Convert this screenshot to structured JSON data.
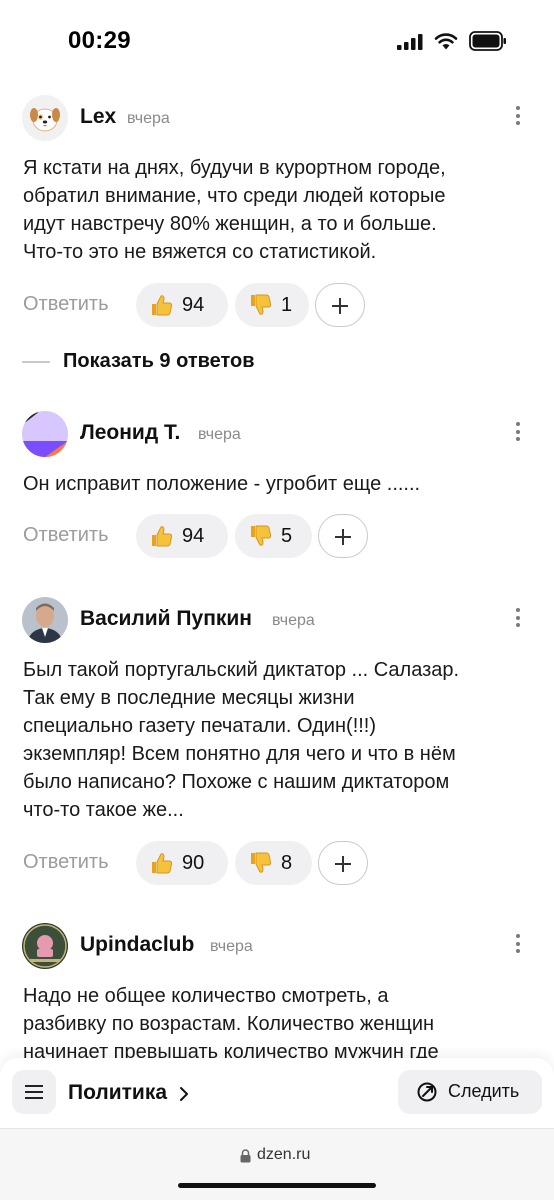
{
  "status": {
    "time": "00:29"
  },
  "comments": [
    {
      "author": "Lex",
      "time": "вчера",
      "text": [
        "Я кстати на днях, будучи в курортном городе,",
        "обратил внимание, что среди людей которые",
        "идут навстречу 80% женщин, а то и больше.",
        "Что-то это не вяжется со статистикой."
      ],
      "reply_label": "Ответить",
      "likes": "94",
      "dislikes": "1",
      "avatar_icon": "dog-avatar"
    },
    {
      "author": "Леонид Т.",
      "time": "вчера",
      "text": [
        "Он исправит положение - угробит еще ......"
      ],
      "reply_label": "Ответить",
      "likes": "94",
      "dislikes": "5",
      "avatar_icon": "abstract-avatar"
    },
    {
      "author": "Василий Пупкин",
      "time": "вчера",
      "text": [
        "Был такой португальский диктатор ... Салазар.",
        "Так ему в последние месяцы жизни",
        "специально газету печатали. Один(!!!)",
        "экземпляр! Всем понятно для чего и что в нём",
        "было написано? Похоже с нашим диктатором",
        "что-то такое же..."
      ],
      "reply_label": "Ответить",
      "likes": "90",
      "dislikes": "8",
      "avatar_icon": "person-photo-avatar"
    },
    {
      "author": "Upindaclub",
      "time": "вчера",
      "text": [
        "Надо не общее количество смотреть, а",
        "разбивку по возрастам. Количество женщин",
        "начинает превышать количество мужчин где"
      ],
      "avatar_icon": "club-logo-avatar"
    }
  ],
  "show_replies": "Показать 9 ответов",
  "bottom_bar": {
    "topic": "Политика",
    "follow_label": "Следить"
  },
  "browser": {
    "url": "dzen.ru"
  },
  "icons": [
    "thumbs-up-icon",
    "thumbs-down-icon",
    "plus-icon",
    "more-icon",
    "menu-icon",
    "chevron-right-icon",
    "follow-icon",
    "lock-icon"
  ]
}
